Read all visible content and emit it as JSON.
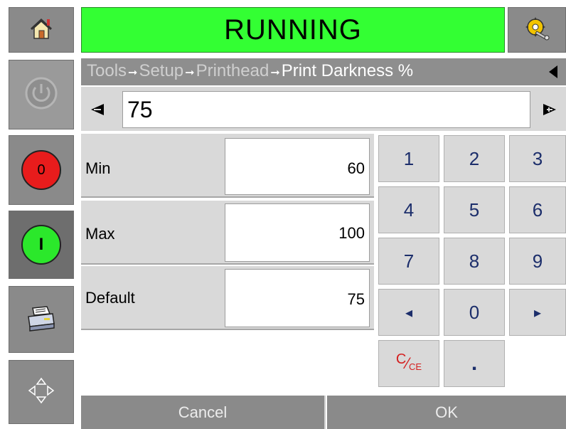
{
  "status": {
    "text": "RUNNING",
    "color": "#33ff33"
  },
  "sidebar": {
    "home_icon": "home-icon",
    "power_icon": "power-icon",
    "stop_label": "0",
    "start_label": "I",
    "printer_icon": "printer-icon",
    "nav_icon": "navigation-arrows-icon"
  },
  "settings_icon": "settings-gear-icon",
  "breadcrumb": {
    "items": [
      "Tools",
      "Setup",
      "Printhead"
    ],
    "current": "Print Darkness %"
  },
  "value": {
    "current": "75"
  },
  "rows": [
    {
      "label": "Min",
      "value": "60"
    },
    {
      "label": "Max",
      "value": "100"
    },
    {
      "label": "Default",
      "value": "75"
    }
  ],
  "keypad": {
    "k1": "1",
    "k2": "2",
    "k3": "3",
    "k4": "4",
    "k5": "5",
    "k6": "6",
    "k7": "7",
    "k8": "8",
    "k9": "9",
    "k0": "0",
    "left": "◂",
    "right": "▸",
    "dot": ".",
    "clear_c": "C",
    "clear_ce": "CE"
  },
  "buttons": {
    "cancel": "Cancel",
    "ok": "OK"
  }
}
